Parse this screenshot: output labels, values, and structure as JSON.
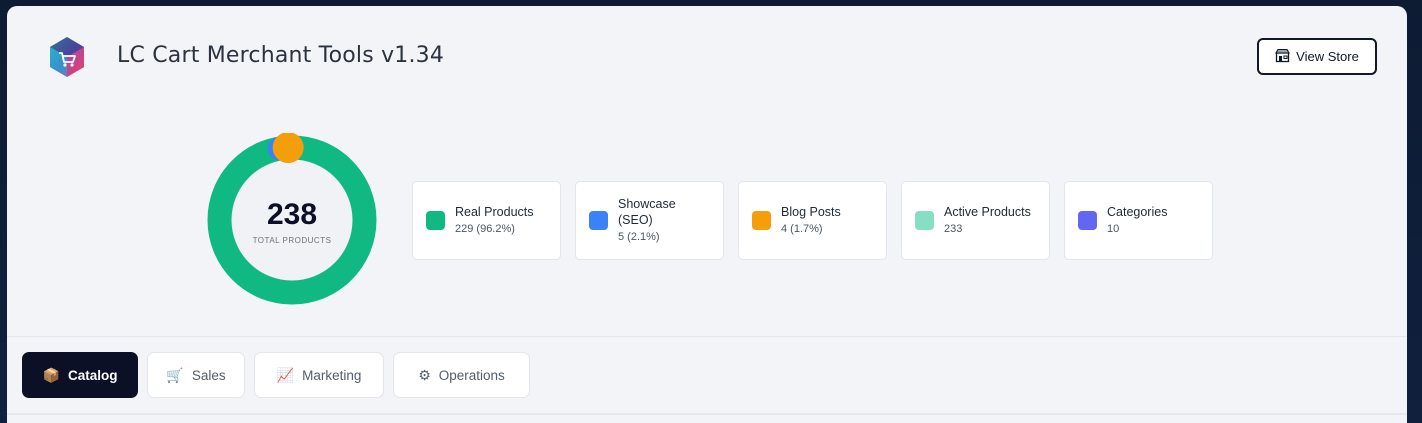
{
  "header": {
    "title": "LC Cart Merchant Tools v1.34",
    "logo_icon": "cart-hexagon-logo",
    "view_store": {
      "label": "View Store",
      "icon": "store-icon"
    }
  },
  "summary": {
    "total": "238",
    "total_label": "TOTAL PRODUCTS"
  },
  "chart_data": {
    "type": "pie",
    "categories": [
      "Real Products",
      "Showcase (SEO)",
      "Blog Posts"
    ],
    "values": [
      229,
      5,
      4
    ],
    "colors": [
      "#10b981",
      "#3b82f6",
      "#f59e0b"
    ]
  },
  "stats": [
    {
      "label": "Real Products",
      "value": "229 (96.2%)",
      "color": "#10b981"
    },
    {
      "label": "Showcase (SEO)",
      "value": "5 (2.1%)",
      "color": "#3b82f6"
    },
    {
      "label": "Blog Posts",
      "value": "4 (1.7%)",
      "color": "#f59e0b"
    },
    {
      "label": "Active Products",
      "value": "233",
      "color": "#86dfc2"
    },
    {
      "label": "Categories",
      "value": "10",
      "color": "#6366f1"
    }
  ],
  "tabs": [
    {
      "label": "Catalog",
      "icon": "box-icon",
      "glyph": "📦",
      "active": true
    },
    {
      "label": "Sales",
      "icon": "cart-icon",
      "glyph": "🛒",
      "active": false
    },
    {
      "label": "Marketing",
      "icon": "chart-icon",
      "glyph": "📈",
      "active": false
    },
    {
      "label": "Operations",
      "icon": "gear-icon",
      "glyph": "⚙",
      "active": false
    }
  ]
}
